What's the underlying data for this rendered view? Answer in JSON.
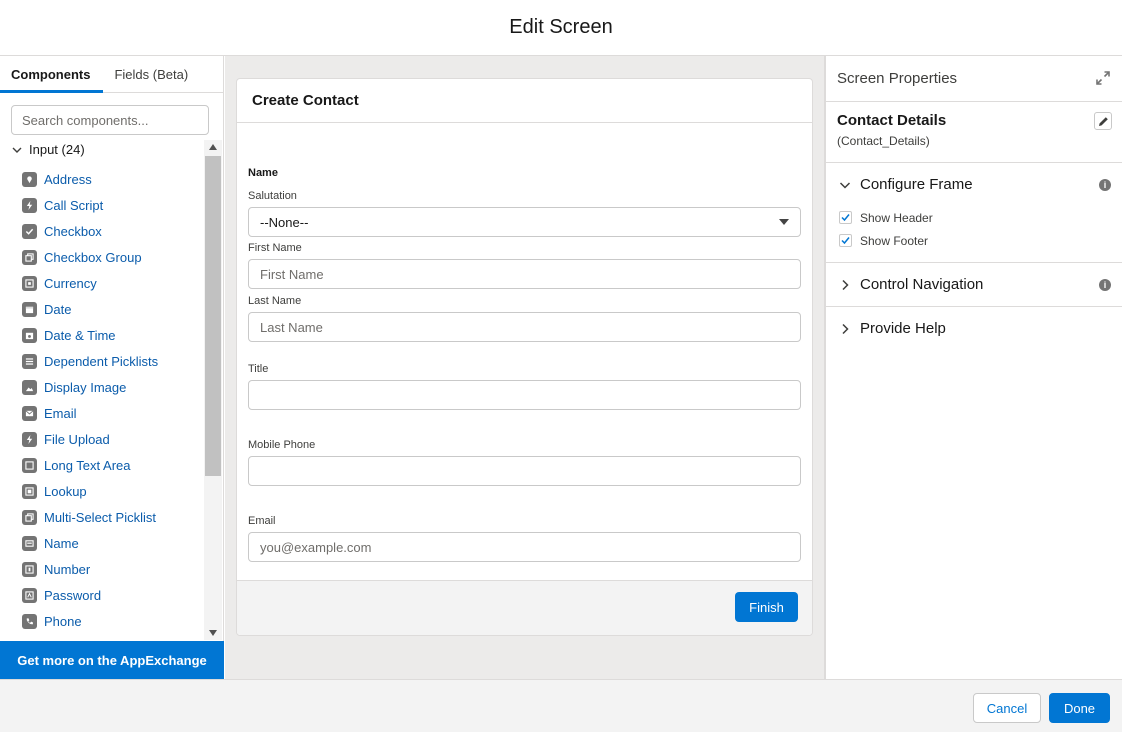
{
  "modal": {
    "title": "Edit Screen"
  },
  "left_panel": {
    "tabs": [
      {
        "label": "Components",
        "active": true
      },
      {
        "label": "Fields (Beta)",
        "active": false
      }
    ],
    "search_placeholder": "Search components...",
    "section_label": "Input (24)",
    "components": [
      {
        "label": "Address",
        "icon": "location-pin-icon"
      },
      {
        "label": "Call Script",
        "icon": "lightning-icon"
      },
      {
        "label": "Checkbox",
        "icon": "checkbox-icon"
      },
      {
        "label": "Checkbox Group",
        "icon": "checkbox-group-icon"
      },
      {
        "label": "Currency",
        "icon": "currency-icon"
      },
      {
        "label": "Date",
        "icon": "calendar-icon"
      },
      {
        "label": "Date & Time",
        "icon": "datetime-icon"
      },
      {
        "label": "Dependent Picklists",
        "icon": "picklist-icon"
      },
      {
        "label": "Display Image",
        "icon": "image-icon"
      },
      {
        "label": "Email",
        "icon": "email-icon"
      },
      {
        "label": "File Upload",
        "icon": "upload-icon"
      },
      {
        "label": "Long Text Area",
        "icon": "textarea-icon"
      },
      {
        "label": "Lookup",
        "icon": "lookup-icon"
      },
      {
        "label": "Multi-Select Picklist",
        "icon": "multiselect-icon"
      },
      {
        "label": "Name",
        "icon": "name-icon"
      },
      {
        "label": "Number",
        "icon": "number-icon"
      },
      {
        "label": "Password",
        "icon": "password-icon"
      },
      {
        "label": "Phone",
        "icon": "phone-icon"
      }
    ],
    "appexchange_label": "Get more on the AppExchange"
  },
  "screen": {
    "title": "Create Contact",
    "name_section": "Name",
    "salutation_label": "Salutation",
    "salutation_value": "--None--",
    "first_name_label": "First Name",
    "first_name_placeholder": "First Name",
    "last_name_label": "Last Name",
    "last_name_placeholder": "Last Name",
    "title_label": "Title",
    "mobile_label": "Mobile Phone",
    "email_label": "Email",
    "email_placeholder": "you@example.com",
    "finish_label": "Finish"
  },
  "right_panel": {
    "header": "Screen Properties",
    "details_title": "Contact Details",
    "details_api": "(Contact_Details)",
    "sections": {
      "configure_frame": "Configure Frame",
      "show_header": "Show Header",
      "show_footer": "Show Footer",
      "control_navigation": "Control Navigation",
      "provide_help": "Provide Help"
    },
    "info_glyph": "i"
  },
  "footer": {
    "cancel": "Cancel",
    "done": "Done"
  },
  "colors": {
    "brand": "#0176d3",
    "link": "#0b5cab",
    "border": "#dddbda",
    "canvas_bg": "#ecebea"
  }
}
